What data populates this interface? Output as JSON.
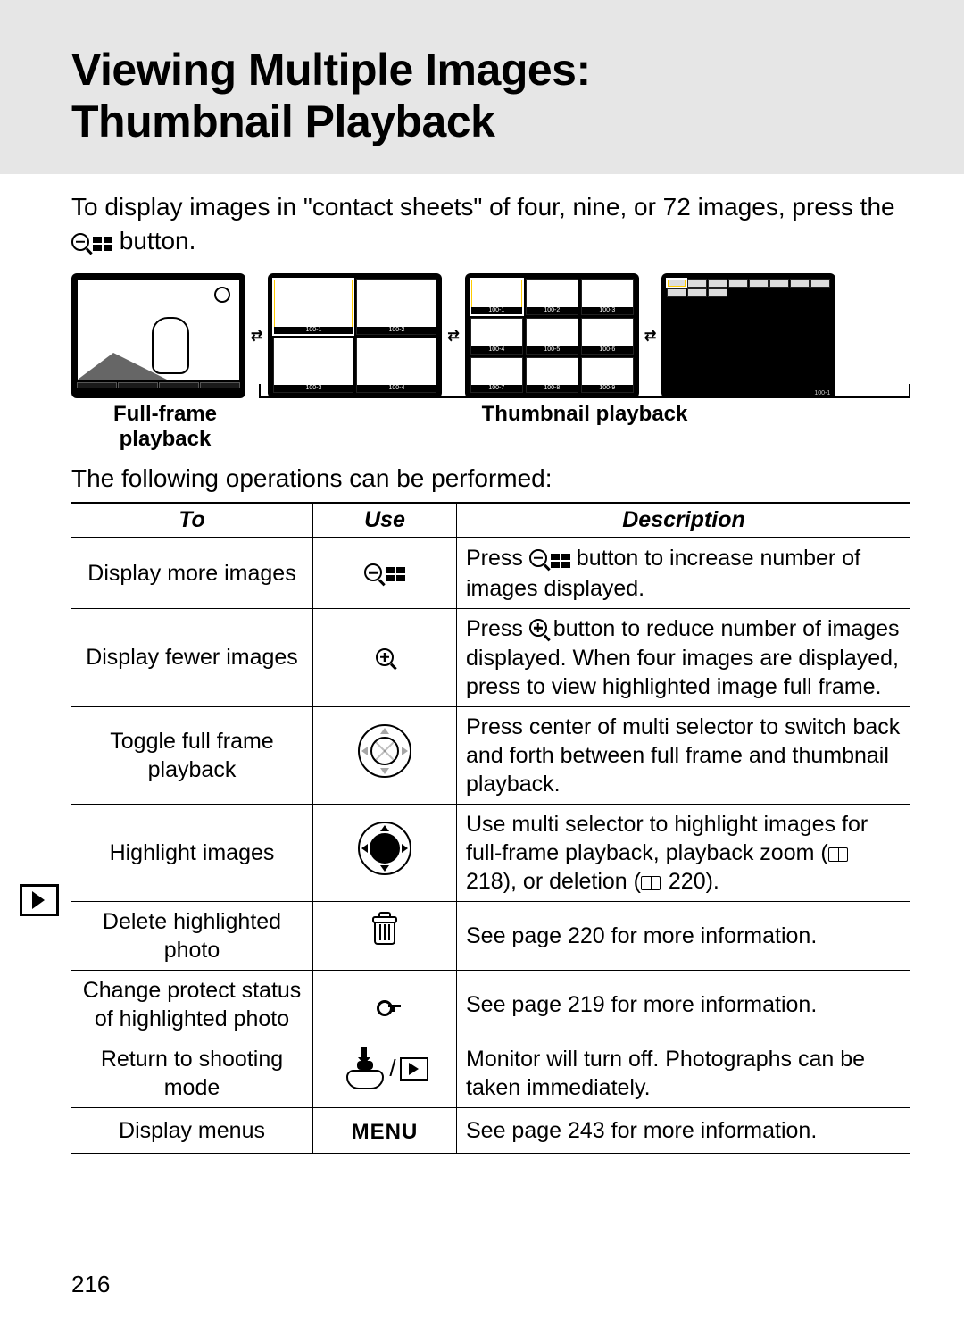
{
  "header": {
    "title_line1": "Viewing Multiple Images:",
    "title_line2": "Thumbnail Playback"
  },
  "intro": {
    "part1": "To display images in \"contact sheets\" of four, nine, or 72 images, press the ",
    "part2": " button."
  },
  "illus": {
    "full_frame_label": "Full-frame playback",
    "thumb_label": "Thumbnail playback",
    "cells4": [
      "100-1",
      "100-2",
      "100-3",
      "100-4"
    ],
    "cells9": [
      "100-1",
      "100-2",
      "100-3",
      "100-4",
      "100-5",
      "100-6",
      "100-7",
      "100-8",
      "100-9"
    ],
    "many_label": "100-1"
  },
  "subintro": "The following operations can be performed:",
  "table": {
    "headers": {
      "to": "To",
      "use": "Use",
      "desc": "Description"
    },
    "rows": [
      {
        "to": "Display more images",
        "icon": "zoomout-grid",
        "desc_pre": "Press ",
        "desc_post": " button to increase number of images displayed."
      },
      {
        "to": "Display fewer images",
        "icon": "zoomin",
        "desc_pre": "Press ",
        "desc_post": " button to reduce number of images displayed. When four images are displayed, press to view highlighted image full frame."
      },
      {
        "to": "Toggle full frame playback",
        "icon": "selector-open",
        "desc": "Press center of multi selector to switch back and forth between full frame and thumbnail playback."
      },
      {
        "to": "Highlight images",
        "icon": "selector-solid",
        "desc_pre": "Use multi selector to highlight images for full-frame playback, playback zoom (",
        "ref1": " 218), or deletion (",
        "ref2": " 220)."
      },
      {
        "to": "Delete highlighted photo",
        "icon": "trash",
        "desc": "See page 220 for more information."
      },
      {
        "to": "Change protect status of highlighted photo",
        "icon": "key",
        "desc": "See page 219 for more information."
      },
      {
        "to": "Return to shooting mode",
        "icon": "shutter-play",
        "desc": "Monitor will turn off.  Photographs can be taken immediately."
      },
      {
        "to": "Display menus",
        "icon": "menu",
        "menu_label": "MENU",
        "desc": "See page 243 for more information."
      }
    ]
  },
  "page_number": "216"
}
